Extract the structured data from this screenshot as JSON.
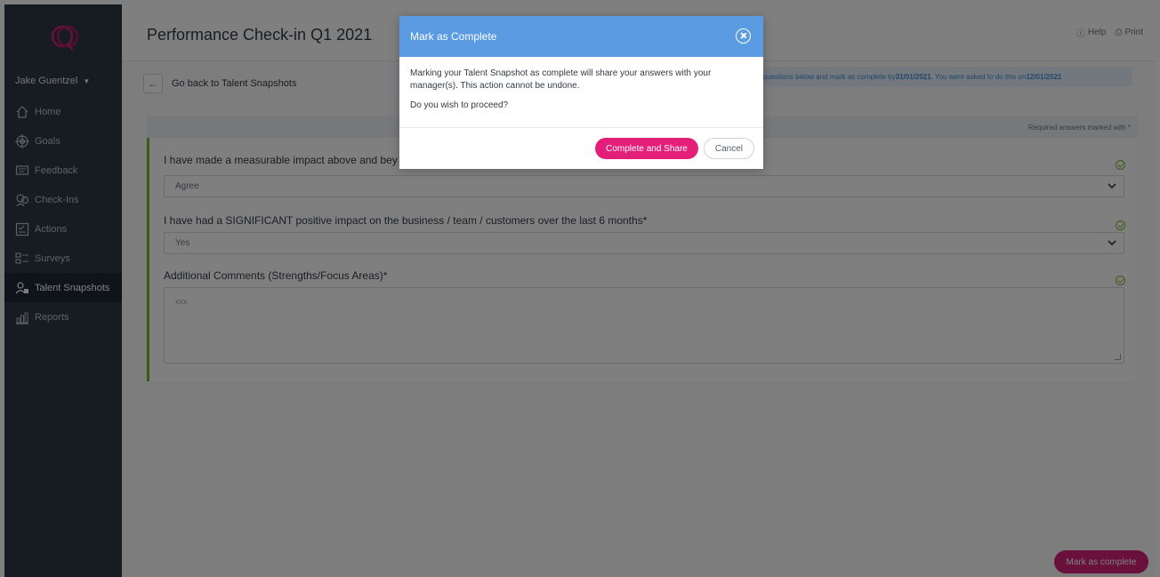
{
  "app": {
    "page_title": "Performance Check-in Q1 2021",
    "help_label": "Help",
    "print_label": "Print"
  },
  "sidebar": {
    "user_name": "Jake Guentzel",
    "items": [
      {
        "label": "Home",
        "icon": "home-icon"
      },
      {
        "label": "Goals",
        "icon": "target-icon"
      },
      {
        "label": "Feedback",
        "icon": "feedback-icon"
      },
      {
        "label": "Check-Ins",
        "icon": "check-ins-icon"
      },
      {
        "label": "Actions",
        "icon": "actions-icon"
      },
      {
        "label": "Surveys",
        "icon": "surveys-icon"
      },
      {
        "label": "Talent Snapshots",
        "icon": "talent-snapshots-icon",
        "active": true
      },
      {
        "label": "Reports",
        "icon": "reports-icon"
      }
    ]
  },
  "main": {
    "back_label": "Go back to Talent Snapshots",
    "notice": {
      "text_prefix": "e questions below and mark as complete by ",
      "due_date": "31/01/2021",
      "text_middle": ". You were asked to do this on ",
      "asked_date": "12/01/2021"
    },
    "required_note": "Required answers marked with *",
    "questions": [
      {
        "text": "I have made a measurable impact above and bey",
        "answer": "Agree"
      },
      {
        "text": "I have had a SIGNIFICANT positive impact on the business / team / customers over the last 6 months*",
        "answer": "Yes"
      },
      {
        "text": "Additional Comments (Strengths/Focus Areas)*",
        "answer": "xxx"
      }
    ],
    "mark_complete_label": "Mark as complete"
  },
  "modal": {
    "title": "Mark as Complete",
    "body_line1": "Marking your Talent Snapshot as complete will share your answers with your manager(s). This action cannot be undone.",
    "body_line2": "Do you wish to proceed?",
    "confirm_label": "Complete and Share",
    "cancel_label": "Cancel"
  },
  "colors": {
    "sidebar_bg": "#2e3947",
    "accent_pink": "#e31f7a",
    "modal_header": "#5b9be2",
    "success_green": "#7ab52c"
  }
}
